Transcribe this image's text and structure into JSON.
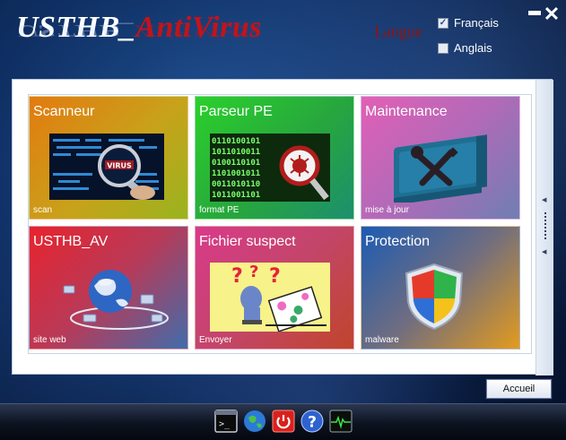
{
  "app": {
    "title_part1": "USTHB_",
    "title_part2": "AntiVirus",
    "colors": {
      "title_white": "#ffffff",
      "title_red": "#c2141a",
      "langue_red": "#8c1414",
      "panel_bg": "#ffffff",
      "background": "#0f2f63"
    }
  },
  "language": {
    "label": "Langue",
    "options": [
      {
        "label": "Français",
        "checked": true
      },
      {
        "label": "Anglais",
        "checked": false
      }
    ]
  },
  "window_controls": {
    "minimize_icon": "minimize-icon",
    "close_icon": "close-icon"
  },
  "tiles": [
    {
      "title": "Scanneur",
      "subtitle": "scan",
      "image": "virus-scan-image"
    },
    {
      "title": "Parseur PE",
      "subtitle": "format PE",
      "image": "binary-bug-magnifier-image"
    },
    {
      "title": "Maintenance",
      "subtitle": "mise à jour",
      "image": "wrench-screwdriver-image"
    },
    {
      "title": "USTHB_AV",
      "subtitle": "site web",
      "image": "globe-network-image"
    },
    {
      "title": "Fichier suspect",
      "subtitle": "Envoyer",
      "image": "puzzled-person-image"
    },
    {
      "title": "Protection",
      "subtitle": "malware",
      "image": "shield-image"
    }
  ],
  "buttons": {
    "accueil": "Accueil"
  },
  "taskbar": {
    "items": [
      "terminal-icon",
      "globe-icon",
      "power-icon",
      "help-icon",
      "monitor-pulse-icon"
    ]
  }
}
